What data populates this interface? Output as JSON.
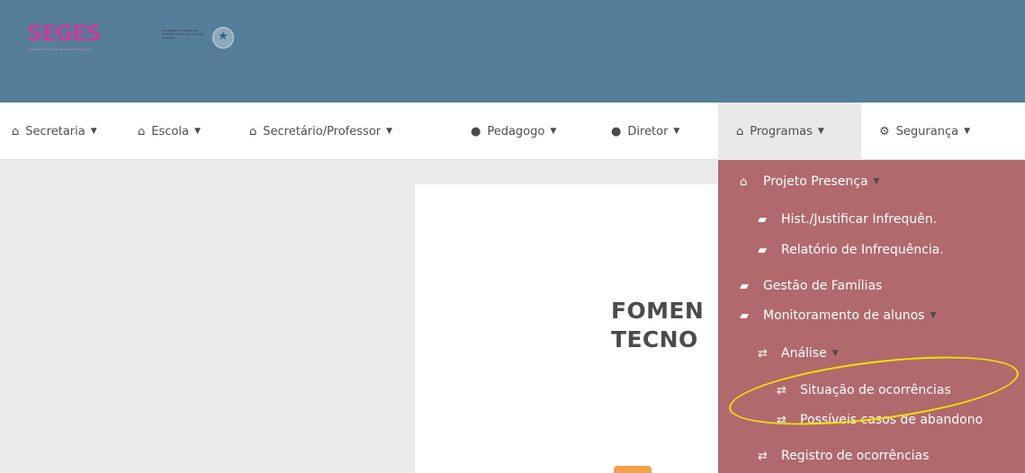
{
  "header": {
    "logo_text": "SEGES",
    "logo_subtitle": "SISTEMA ESTADUAL DE GESTÃO ESCOLAR",
    "government_text": "GOVERNO DO ESTADO DO ESPÍRITO SANTO Secretaria da Educação"
  },
  "nav": {
    "items": [
      {
        "label": "Secretaria",
        "icon": "home-icon"
      },
      {
        "label": "Escola",
        "icon": "home-icon"
      },
      {
        "label": "Secretário/Professor",
        "icon": "home-icon"
      },
      {
        "label": "Pedagogo",
        "icon": "user-icon"
      },
      {
        "label": "Diretor",
        "icon": "user-icon"
      },
      {
        "label": "Programas",
        "icon": "home-icon"
      },
      {
        "label": "Segurança",
        "icon": "gear-icon"
      }
    ]
  },
  "dropdown": {
    "project_presence": "Projeto Presença",
    "history": "Hist./Justificar Infrequên.",
    "infrequency_report": "Relatório de Infrequência.",
    "family_management": "Gestão de Famílias",
    "student_monitoring": "Monitoramento de alunos",
    "analysis": "Análise",
    "occurrence_status": "Situação de ocorrências",
    "abandonment_cases": "Possíveis casos de abandono",
    "occurrence_register": "Registro de ocorrências"
  },
  "content": {
    "title_line_1": "FOMEN",
    "title_line_2": "TECNO"
  },
  "colors": {
    "header": "#557e9b",
    "dropdown": "#b0696c",
    "highlight": "#f1e300",
    "accent": "#f5a04c"
  }
}
